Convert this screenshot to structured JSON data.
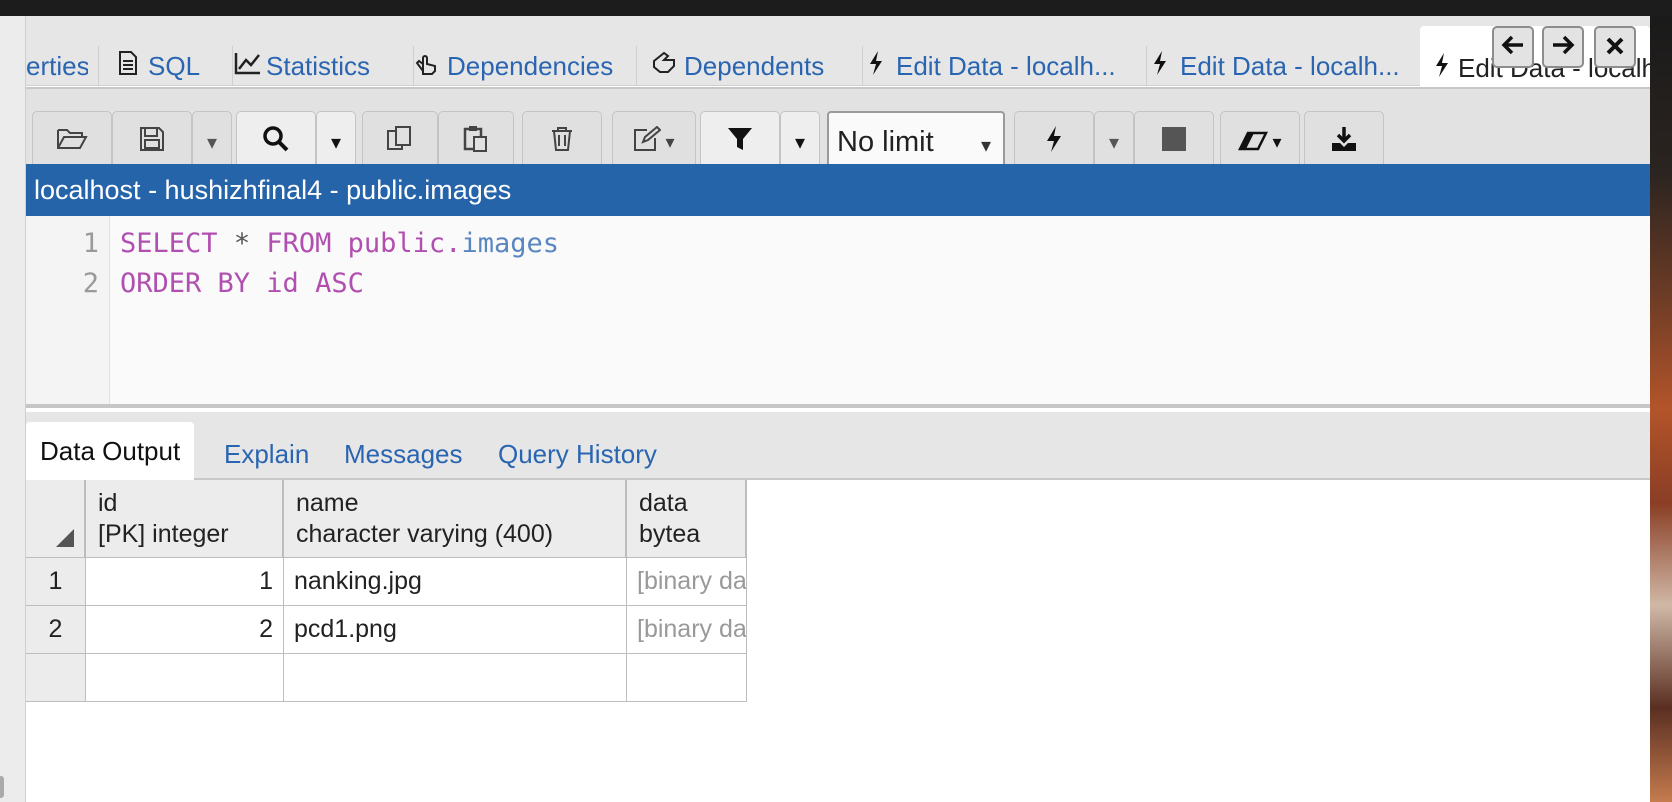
{
  "tabs": [
    {
      "label": "erties",
      "icon": "properties-icon"
    },
    {
      "label": "SQL",
      "icon": "file-text-icon"
    },
    {
      "label": "Statistics",
      "icon": "line-chart-icon"
    },
    {
      "label": "Dependencies",
      "icon": "hand-pointer-icon"
    },
    {
      "label": "Dependents",
      "icon": "hand-icon"
    },
    {
      "label": "Edit Data - localh...",
      "icon": "bolt-icon"
    },
    {
      "label": "Edit Data - localh...",
      "icon": "bolt-icon"
    },
    {
      "label": "Edit Data - localho",
      "icon": "bolt-icon",
      "active": true
    }
  ],
  "nav": {
    "back_icon": "arrow-left-icon",
    "forward_icon": "arrow-right-icon",
    "close_icon": "close-icon"
  },
  "toolbar": {
    "row_limit": "No limit"
  },
  "path": "localhost - hushizhfinal4 - public.images",
  "editor": {
    "lines": [
      {
        "number": "1",
        "tokens": [
          "SELECT",
          "*",
          "FROM",
          "public.",
          "images"
        ]
      },
      {
        "number": "2",
        "tokens": [
          "ORDER BY id ASC"
        ]
      }
    ]
  },
  "result_tabs": [
    "Data Output",
    "Explain",
    "Messages",
    "Query History"
  ],
  "grid": {
    "columns": [
      {
        "name": "id",
        "type": "[PK] integer"
      },
      {
        "name": "name",
        "type": "character varying (400)"
      },
      {
        "name": "data",
        "type": "bytea"
      }
    ],
    "rows": [
      {
        "rownum": "1",
        "id": "1",
        "name": "nanking.jpg",
        "data": "[binary data]"
      },
      {
        "rownum": "2",
        "id": "2",
        "name": "pcd1.png",
        "data": "[binary data]"
      }
    ]
  }
}
